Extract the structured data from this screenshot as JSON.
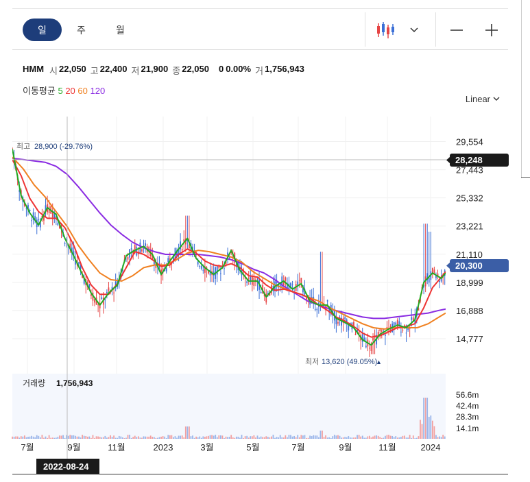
{
  "tabs": [
    {
      "label": "일",
      "active": true
    },
    {
      "label": "주",
      "active": false
    },
    {
      "label": "월",
      "active": false
    }
  ],
  "toolbar": {
    "chart_type_icon": "candlestick-icon",
    "dropdown_icon": "chevron-down-icon",
    "zoom_out": "—",
    "zoom_in": "+"
  },
  "quote": {
    "ticker": "HMM",
    "open_label": "시",
    "open": "22,050",
    "high_label": "고",
    "high": "22,400",
    "low_label": "저",
    "low": "21,900",
    "close_label": "종",
    "close": "22,050",
    "change": "0",
    "change_pct": "0.00%",
    "volume_label": "거",
    "volume": "1,756,943"
  },
  "moving_average": {
    "label": "이동평균",
    "periods": [
      {
        "value": "5",
        "color": "#22aa22"
      },
      {
        "value": "20",
        "color": "#ee3333"
      },
      {
        "value": "60",
        "color": "#f08020"
      },
      {
        "value": "120",
        "color": "#8a2be2"
      }
    ]
  },
  "scale_selector": {
    "label": "Linear"
  },
  "colors": {
    "up": "#e64545",
    "down": "#3b6fd6",
    "accent": "#1d3d7a",
    "badge_dark": "#1a1a1a"
  },
  "chart_data": {
    "type": "candlestick",
    "title": "HMM",
    "x_ticks": [
      "7월",
      "9월",
      "11월",
      "2023",
      "3월",
      "5월",
      "7월",
      "9월",
      "11월",
      "2024"
    ],
    "price_ticks": [
      "29,554",
      "27,443",
      "25,332",
      "23,221",
      "21,110",
      "18,999",
      "16,888",
      "14,777"
    ],
    "ylim": [
      13000,
      30500
    ],
    "crosshair": {
      "price": "28,248",
      "date": "2022-08-24"
    },
    "current_price": "20,300",
    "high_annotation": {
      "label": "최고",
      "value": "28,900 (-29.76%)"
    },
    "low_annotation": {
      "label": "최저",
      "value": "13,620 (49.05%)"
    },
    "volume_title": "거래량",
    "volume_value": "1,756,943",
    "volume_ticks": [
      "56.6m",
      "42.4m",
      "28.3m",
      "14.1m"
    ],
    "ma_points": {
      "ma5": [
        [
          0,
          29000
        ],
        [
          8,
          25500
        ],
        [
          16,
          24200
        ],
        [
          24,
          23300
        ],
        [
          32,
          24600
        ],
        [
          40,
          24100
        ],
        [
          48,
          22300
        ],
        [
          56,
          21000
        ],
        [
          64,
          19600
        ],
        [
          72,
          18200
        ],
        [
          80,
          17300
        ],
        [
          88,
          18200
        ],
        [
          96,
          18800
        ],
        [
          104,
          21000
        ],
        [
          112,
          21400
        ],
        [
          120,
          21700
        ],
        [
          128,
          21100
        ],
        [
          136,
          19600
        ],
        [
          144,
          20600
        ],
        [
          152,
          21500
        ],
        [
          160,
          22300
        ],
        [
          168,
          20800
        ],
        [
          176,
          20100
        ],
        [
          184,
          19600
        ],
        [
          192,
          20100
        ],
        [
          200,
          21400
        ],
        [
          208,
          19900
        ],
        [
          216,
          19100
        ],
        [
          224,
          19100
        ],
        [
          232,
          17900
        ],
        [
          240,
          18700
        ],
        [
          248,
          19100
        ],
        [
          256,
          18500
        ],
        [
          264,
          18900
        ],
        [
          272,
          17600
        ],
        [
          280,
          17300
        ],
        [
          288,
          17300
        ],
        [
          296,
          16300
        ],
        [
          304,
          16000
        ],
        [
          312,
          15600
        ],
        [
          320,
          14700
        ],
        [
          328,
          14300
        ],
        [
          336,
          15100
        ],
        [
          344,
          15500
        ],
        [
          352,
          15800
        ],
        [
          360,
          15600
        ],
        [
          368,
          16200
        ],
        [
          376,
          19000
        ],
        [
          384,
          19700
        ],
        [
          392,
          19300
        ],
        [
          396,
          19700
        ]
      ],
      "ma20": [
        [
          0,
          28200
        ],
        [
          8,
          27000
        ],
        [
          16,
          25300
        ],
        [
          24,
          24300
        ],
        [
          32,
          23800
        ],
        [
          40,
          23800
        ],
        [
          48,
          23100
        ],
        [
          56,
          21800
        ],
        [
          64,
          20100
        ],
        [
          72,
          18800
        ],
        [
          80,
          18100
        ],
        [
          88,
          18100
        ],
        [
          96,
          18900
        ],
        [
          104,
          20100
        ],
        [
          112,
          21300
        ],
        [
          120,
          21100
        ],
        [
          128,
          20700
        ],
        [
          136,
          20200
        ],
        [
          144,
          20300
        ],
        [
          152,
          21100
        ],
        [
          160,
          21500
        ],
        [
          168,
          21200
        ],
        [
          176,
          20600
        ],
        [
          184,
          20300
        ],
        [
          192,
          20200
        ],
        [
          200,
          20400
        ],
        [
          208,
          20100
        ],
        [
          216,
          19500
        ],
        [
          224,
          19400
        ],
        [
          232,
          18800
        ],
        [
          240,
          18400
        ],
        [
          248,
          18500
        ],
        [
          256,
          18300
        ],
        [
          264,
          18100
        ],
        [
          272,
          17800
        ],
        [
          280,
          17300
        ],
        [
          288,
          16900
        ],
        [
          296,
          16400
        ],
        [
          304,
          16100
        ],
        [
          312,
          15700
        ],
        [
          320,
          15200
        ],
        [
          328,
          14900
        ],
        [
          336,
          15000
        ],
        [
          344,
          15300
        ],
        [
          352,
          15600
        ],
        [
          360,
          15700
        ],
        [
          368,
          15900
        ],
        [
          376,
          17100
        ],
        [
          384,
          18600
        ],
        [
          392,
          19400
        ],
        [
          396,
          19800
        ]
      ],
      "ma60": [
        [
          0,
          28400
        ],
        [
          10,
          27500
        ],
        [
          20,
          26300
        ],
        [
          30,
          25400
        ],
        [
          40,
          24300
        ],
        [
          50,
          23200
        ],
        [
          60,
          21800
        ],
        [
          70,
          20700
        ],
        [
          80,
          19700
        ],
        [
          90,
          19200
        ],
        [
          100,
          19100
        ],
        [
          110,
          19500
        ],
        [
          120,
          20100
        ],
        [
          130,
          20300
        ],
        [
          140,
          20300
        ],
        [
          150,
          20700
        ],
        [
          160,
          21200
        ],
        [
          170,
          21400
        ],
        [
          180,
          21300
        ],
        [
          190,
          21100
        ],
        [
          200,
          20900
        ],
        [
          210,
          20500
        ],
        [
          220,
          19800
        ],
        [
          230,
          19300
        ],
        [
          240,
          18800
        ],
        [
          250,
          18500
        ],
        [
          260,
          18200
        ],
        [
          270,
          17900
        ],
        [
          280,
          17600
        ],
        [
          290,
          17100
        ],
        [
          300,
          16700
        ],
        [
          310,
          16300
        ],
        [
          320,
          15900
        ],
        [
          330,
          15600
        ],
        [
          340,
          15500
        ],
        [
          350,
          15600
        ],
        [
          360,
          15600
        ],
        [
          370,
          15600
        ],
        [
          380,
          15900
        ],
        [
          390,
          16400
        ],
        [
          396,
          16700
        ]
      ],
      "ma120": [
        [
          0,
          28300
        ],
        [
          10,
          28200
        ],
        [
          20,
          28100
        ],
        [
          30,
          28000
        ],
        [
          40,
          27700
        ],
        [
          50,
          27100
        ],
        [
          60,
          26200
        ],
        [
          70,
          25200
        ],
        [
          80,
          24200
        ],
        [
          90,
          23300
        ],
        [
          100,
          22600
        ],
        [
          110,
          22000
        ],
        [
          120,
          21600
        ],
        [
          130,
          21300
        ],
        [
          140,
          21100
        ],
        [
          150,
          21100
        ],
        [
          160,
          21100
        ],
        [
          170,
          21100
        ],
        [
          180,
          21000
        ],
        [
          190,
          20900
        ],
        [
          200,
          20700
        ],
        [
          210,
          20400
        ],
        [
          220,
          20000
        ],
        [
          230,
          19700
        ],
        [
          240,
          19200
        ],
        [
          250,
          18600
        ],
        [
          260,
          18100
        ],
        [
          270,
          17600
        ],
        [
          280,
          17300
        ],
        [
          290,
          17000
        ],
        [
          300,
          16800
        ],
        [
          310,
          16600
        ],
        [
          320,
          16400
        ],
        [
          330,
          16300
        ],
        [
          340,
          16300
        ],
        [
          350,
          16400
        ],
        [
          360,
          16500
        ],
        [
          370,
          16600
        ],
        [
          380,
          16700
        ],
        [
          390,
          16900
        ],
        [
          396,
          17000
        ]
      ]
    }
  }
}
